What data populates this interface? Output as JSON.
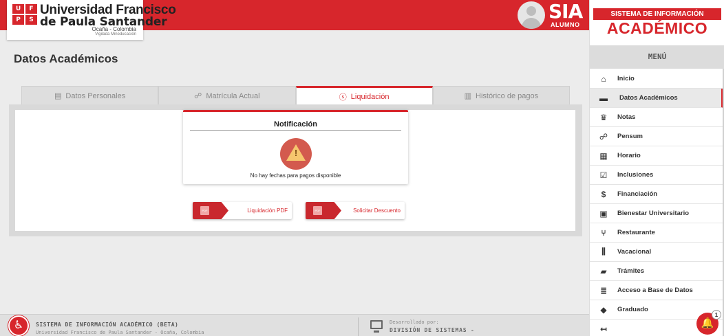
{
  "header": {
    "logo_mark": [
      "U",
      "F",
      "P",
      "S"
    ],
    "logo_line1": "Universidad Francisco",
    "logo_line2": "de Paula Santander",
    "logo_line3": "Ocaña - Colombia",
    "logo_line4": "Vigilada Mineducación",
    "sia_title": "SIA",
    "sia_subtitle": "ALUMNO",
    "accent_color": "#d7262c"
  },
  "page": {
    "title": "Datos Académicos"
  },
  "tabs": [
    {
      "label": "Datos Personales",
      "icon": "id-card-icon",
      "active": false
    },
    {
      "label": "Matrícula Actual",
      "icon": "sitemap-icon",
      "active": false
    },
    {
      "label": "Liquidación",
      "icon": "dollar-circle-icon",
      "active": true
    },
    {
      "label": "Histórico de pagos",
      "icon": "chart-icon",
      "active": false
    }
  ],
  "notification": {
    "title": "Notificación",
    "message": "No hay fechas para pagos disponible",
    "icon": "warning-icon",
    "icon_glyph": "!"
  },
  "actions": {
    "pdf_label": "Liquidación PDF",
    "discount_label": "Solicitar Descuento",
    "pdf_badge": "PDF"
  },
  "footer": {
    "title": "SISTEMA DE INFORMACIÓN ACADÉMICO (BETA)",
    "subtitle": "Universidad Francisco de Paula Santander - Ocaña, Colombia",
    "dev_label": "Desarrollado por:",
    "dev_name": "DIVISIÓN DE SISTEMAS -"
  },
  "sidebar": {
    "heading_small": "SISTEMA DE INFORMACIÓN",
    "heading_big": "ACADÉMICO",
    "menu_label": "MENÚ",
    "items": [
      {
        "label": "Inicio",
        "icon": "home-icon",
        "glyph": "⌂"
      },
      {
        "label": "Datos Académicos",
        "icon": "card-icon",
        "glyph": "▬",
        "active": true
      },
      {
        "label": "Notas",
        "icon": "trophy-icon",
        "glyph": "♛"
      },
      {
        "label": "Pensum",
        "icon": "sitemap-icon",
        "glyph": "☍"
      },
      {
        "label": "Horario",
        "icon": "calendar-icon",
        "glyph": "▦"
      },
      {
        "label": "Inclusiones",
        "icon": "check-square-icon",
        "glyph": "☑"
      },
      {
        "label": "Financiación",
        "icon": "dollar-circle-icon",
        "glyph": "$"
      },
      {
        "label": "Bienestar Universitario",
        "icon": "briefcase-icon",
        "glyph": "▣"
      },
      {
        "label": "Restaurante",
        "icon": "utensils-icon",
        "glyph": "⑂"
      },
      {
        "label": "Vacacional",
        "icon": "books-icon",
        "glyph": "⫼"
      },
      {
        "label": "Trámites",
        "icon": "folder-icon",
        "glyph": "▰"
      },
      {
        "label": "Acceso a Base de Datos",
        "icon": "database-icon",
        "glyph": "≣"
      },
      {
        "label": "Graduado",
        "icon": "graduation-cap-icon",
        "glyph": "◆"
      },
      {
        "label": "",
        "icon": "logout-icon",
        "glyph": "↤"
      }
    ]
  },
  "notifications_badge": "1"
}
